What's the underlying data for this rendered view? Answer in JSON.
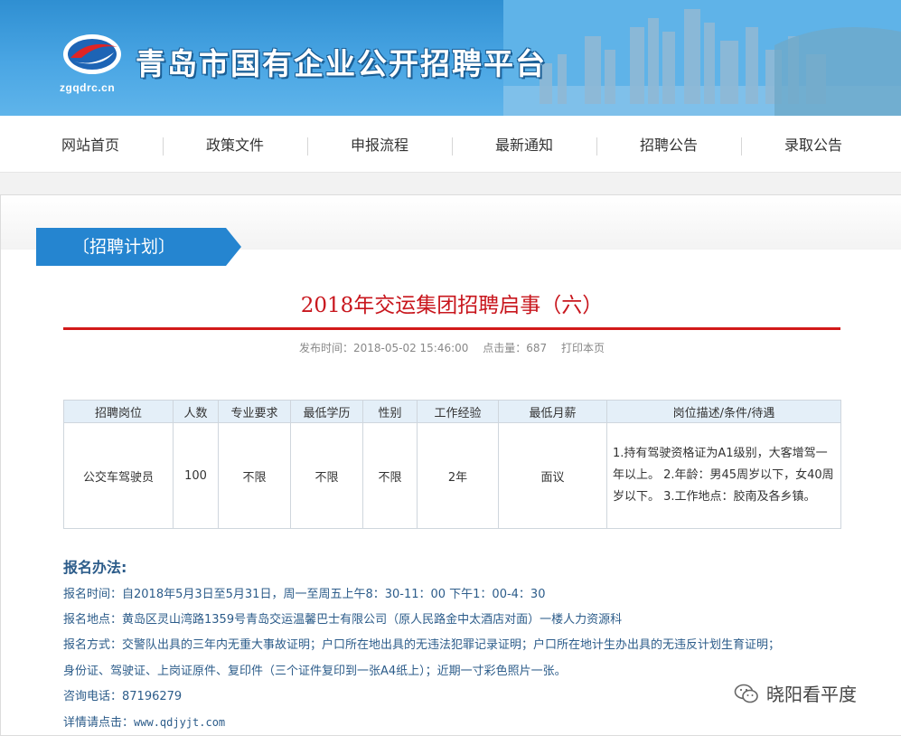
{
  "header": {
    "site_title": "青岛市国有企业公开招聘平台",
    "logo_text": "zgqdrc.cn",
    "bg_color": "#3a9bdc"
  },
  "nav": {
    "items": [
      "网站首页",
      "政策文件",
      "申报流程",
      "最新通知",
      "招聘公告",
      "录取公告"
    ]
  },
  "section_tag": "〔招聘计划〕",
  "article": {
    "title": "2018年交运集团招聘启事（六）",
    "publish_label": "发布时间：",
    "publish_time": "2018-05-02 15:46:00",
    "hits_label": "点击量：",
    "hits": "687",
    "print_label": "打印本页"
  },
  "table": {
    "headers": [
      "招聘岗位",
      "人数",
      "专业要求",
      "最低学历",
      "性别",
      "工作经验",
      "最低月薪",
      "岗位描述/条件/待遇"
    ],
    "rows": [
      [
        "公交车驾驶员",
        "100",
        "不限",
        "不限",
        "不限",
        "2年",
        "面议",
        "1.持有驾驶资格证为A1级别，大客增驾一年以上。 2.年龄：男45周岁以下，女40周岁以下。 3.工作地点：胶南及各乡镇。"
      ]
    ]
  },
  "apply": {
    "title": "报名办法:",
    "time": "报名时间：自2018年5月3日至5月31日，周一至周五上午8：30-11：00 下午1：00-4：30",
    "place": "报名地点：黄岛区灵山湾路1359号青岛交运温馨巴士有限公司（原人民路金中太酒店对面）一楼人力资源科",
    "method": "报名方式：交警队出具的三年内无重大事故证明；户口所在地出具的无违法犯罪记录证明；户口所在地计生办出具的无违反计划生育证明；",
    "method_cont": "身份证、驾驶证、上岗证原件、复印件（三个证件复印到一张A4纸上）；近期一寸彩色照片一张。",
    "phone": "咨询电话：87196279",
    "detail_label": "详情请点击：",
    "detail_link": "www.qdjyjt.com"
  },
  "watermark": "晓阳看平度"
}
